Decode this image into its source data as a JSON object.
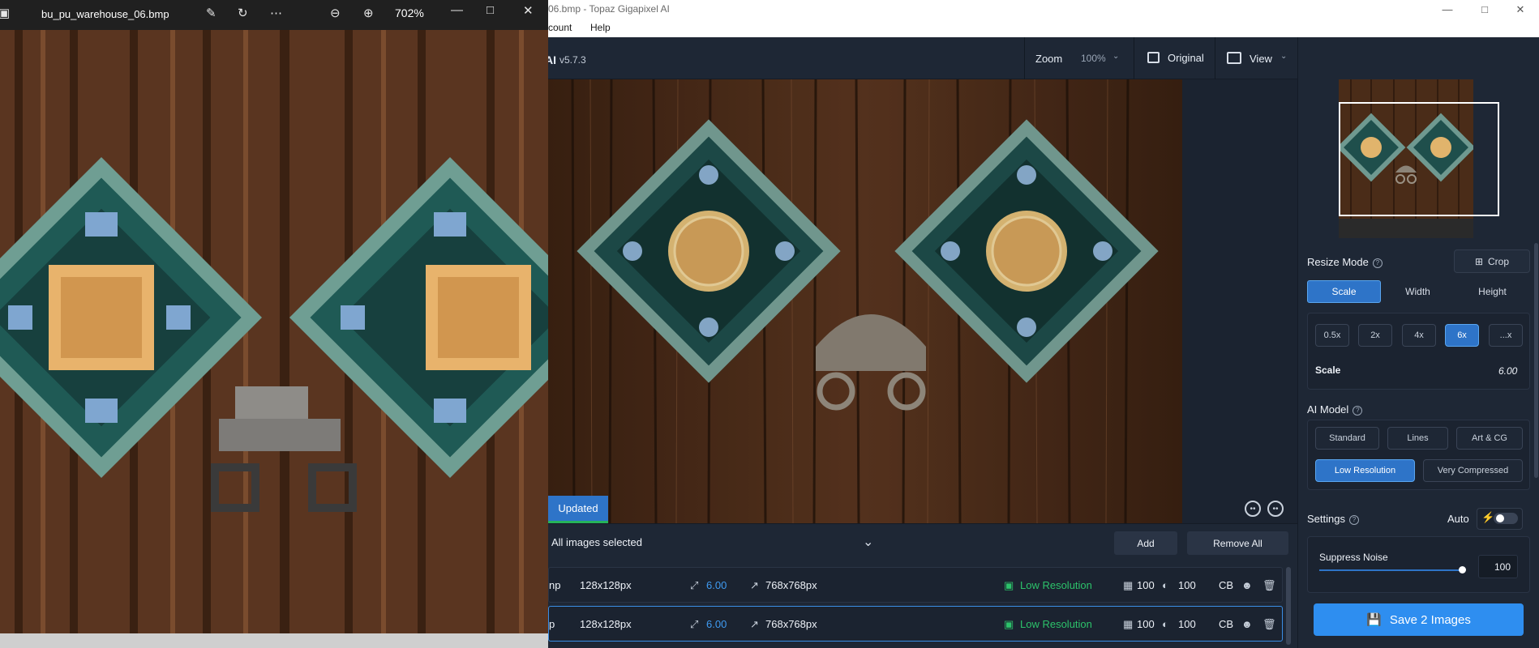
{
  "gigapixel": {
    "window_title": "06.bmp - Topaz Gigapixel AI",
    "menu": [
      "count",
      "Help"
    ],
    "brand": "AI",
    "version": "v5.7.3",
    "zoom": {
      "label": "Zoom",
      "value": "100%"
    },
    "original_label": "Original",
    "view_label": "View",
    "updated_badge": "Updated",
    "list": {
      "selection_text": "All images selected",
      "add_label": "Add",
      "remove_all_label": "Remove All",
      "rows": [
        {
          "name": "np",
          "input_size": "128x128px",
          "scale": "6.00",
          "output_size": "768x768px",
          "model": "Low Resolution",
          "noise": "100",
          "blur": "100",
          "flag": "CB"
        },
        {
          "name": "p",
          "input_size": "128x128px",
          "scale": "6.00",
          "output_size": "768x768px",
          "model": "Low Resolution",
          "noise": "100",
          "blur": "100",
          "flag": "CB"
        }
      ]
    },
    "panel": {
      "resize_mode_title": "Resize Mode",
      "crop_label": "Crop",
      "resize_tabs": [
        "Scale",
        "Width",
        "Height"
      ],
      "active_resize_tab": "Scale",
      "scale_options": [
        "0.5x",
        "2x",
        "4x",
        "6x",
        "...x"
      ],
      "active_scale": "6x",
      "scale_label": "Scale",
      "scale_value": "6.00",
      "ai_model_title": "AI Model",
      "models_row1": [
        "Standard",
        "Lines",
        "Art & CG"
      ],
      "models_row2": [
        "Low Resolution",
        "Very Compressed"
      ],
      "active_model": "Low Resolution",
      "settings_title": "Settings",
      "auto_label": "Auto",
      "suppress_noise_label": "Suppress Noise",
      "suppress_noise_value": "100",
      "save_label": "Save 2 Images"
    }
  },
  "photos": {
    "file_name": "bu_pu_warehouse_06.bmp",
    "zoom": "702%",
    "window_controls": [
      "minimize-icon",
      "maximize-icon",
      "close-icon"
    ]
  },
  "colors": {
    "accent_blue": "#2e74c8",
    "save_blue": "#2e8ef0",
    "model_green": "#2cc26a",
    "panel_bg": "#1e2735",
    "wood_brown": "#5a3520",
    "ornament_teal": "#1f5a55"
  }
}
